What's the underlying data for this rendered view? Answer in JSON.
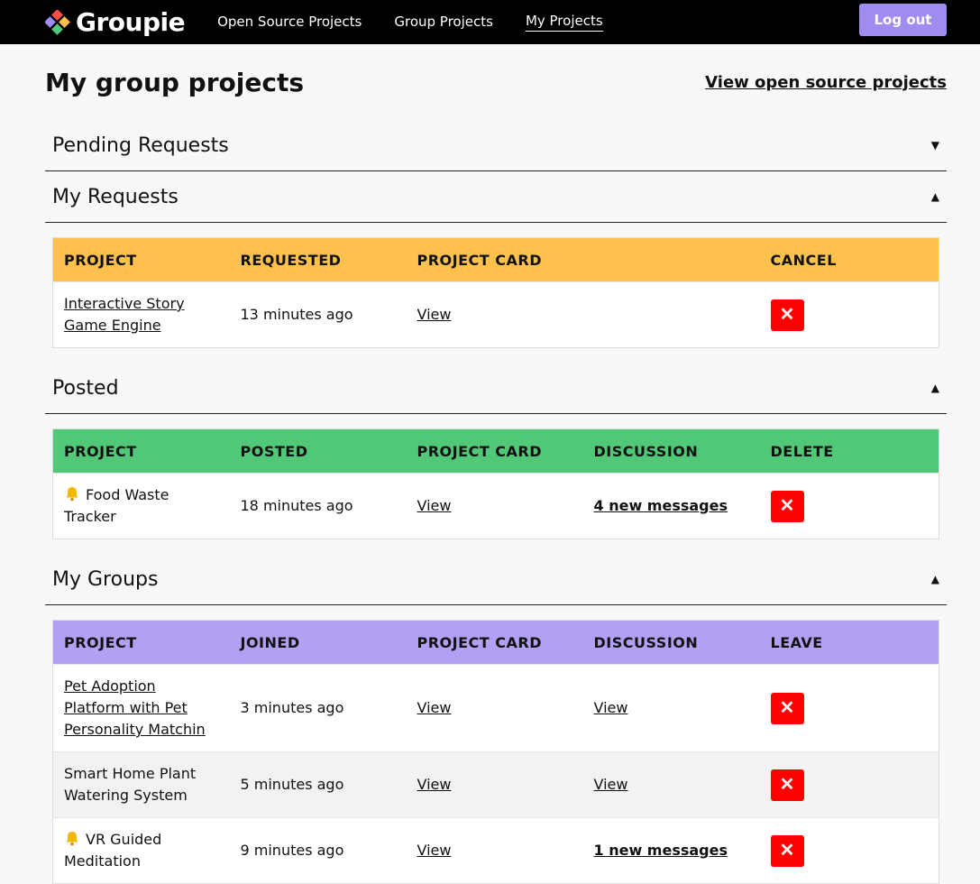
{
  "navbar": {
    "brand": "Groupie",
    "links": [
      {
        "label": "Open Source Projects"
      },
      {
        "label": "Group Projects"
      },
      {
        "label": "My Projects"
      }
    ],
    "logout_label": "Log out"
  },
  "page": {
    "title": "My group projects",
    "header_link": "View open source projects"
  },
  "sections": {
    "pending": {
      "title": "Pending Requests",
      "caret": "▼"
    },
    "requests": {
      "title": "My Requests",
      "caret": "▲",
      "headers": [
        "PROJECT",
        "REQUESTED",
        "PROJECT CARD",
        "",
        "CANCEL"
      ],
      "rows": [
        {
          "project": "Interactive Story Game Engine",
          "time": "13 minutes ago",
          "card": "View",
          "action": "✕"
        }
      ]
    },
    "posted": {
      "title": "Posted",
      "caret": "▲",
      "headers": [
        "PROJECT",
        "POSTED",
        "PROJECT CARD",
        "DISCUSSION",
        "DELETE"
      ],
      "rows": [
        {
          "project": "Food Waste Tracker",
          "time": "18 minutes ago",
          "card": "View",
          "discussion": "4 new messages",
          "action": "✕"
        }
      ]
    },
    "groups": {
      "title": "My Groups",
      "caret": "▲",
      "headers": [
        "PROJECT",
        "JOINED",
        "PROJECT CARD",
        "DISCUSSION",
        "LEAVE"
      ],
      "rows": [
        {
          "project": "Pet Adoption Platform with Pet Personality Matchin",
          "time": "3 minutes ago",
          "card": "View",
          "discussion": "View",
          "action": "✕"
        },
        {
          "project": "Smart Home Plant Watering System",
          "time": "5 minutes ago",
          "card": "View",
          "discussion": "View",
          "action": "✕"
        },
        {
          "project": "VR Guided Meditation",
          "time": "9 minutes ago",
          "card": "View",
          "discussion": "1 new messages",
          "action": "✕"
        }
      ]
    }
  },
  "colors": {
    "requests_header": "#ffc14d",
    "posted_header": "#50c878",
    "groups_header": "#b2a0f4",
    "logout_button": "#a08cf0",
    "action_button": "#ff0000"
  },
  "icons": {
    "logo": "groupie-logo-icon",
    "bell": "bell-icon",
    "caret_down": "caret-down-icon",
    "caret_up": "caret-up-icon",
    "close": "close-icon"
  }
}
